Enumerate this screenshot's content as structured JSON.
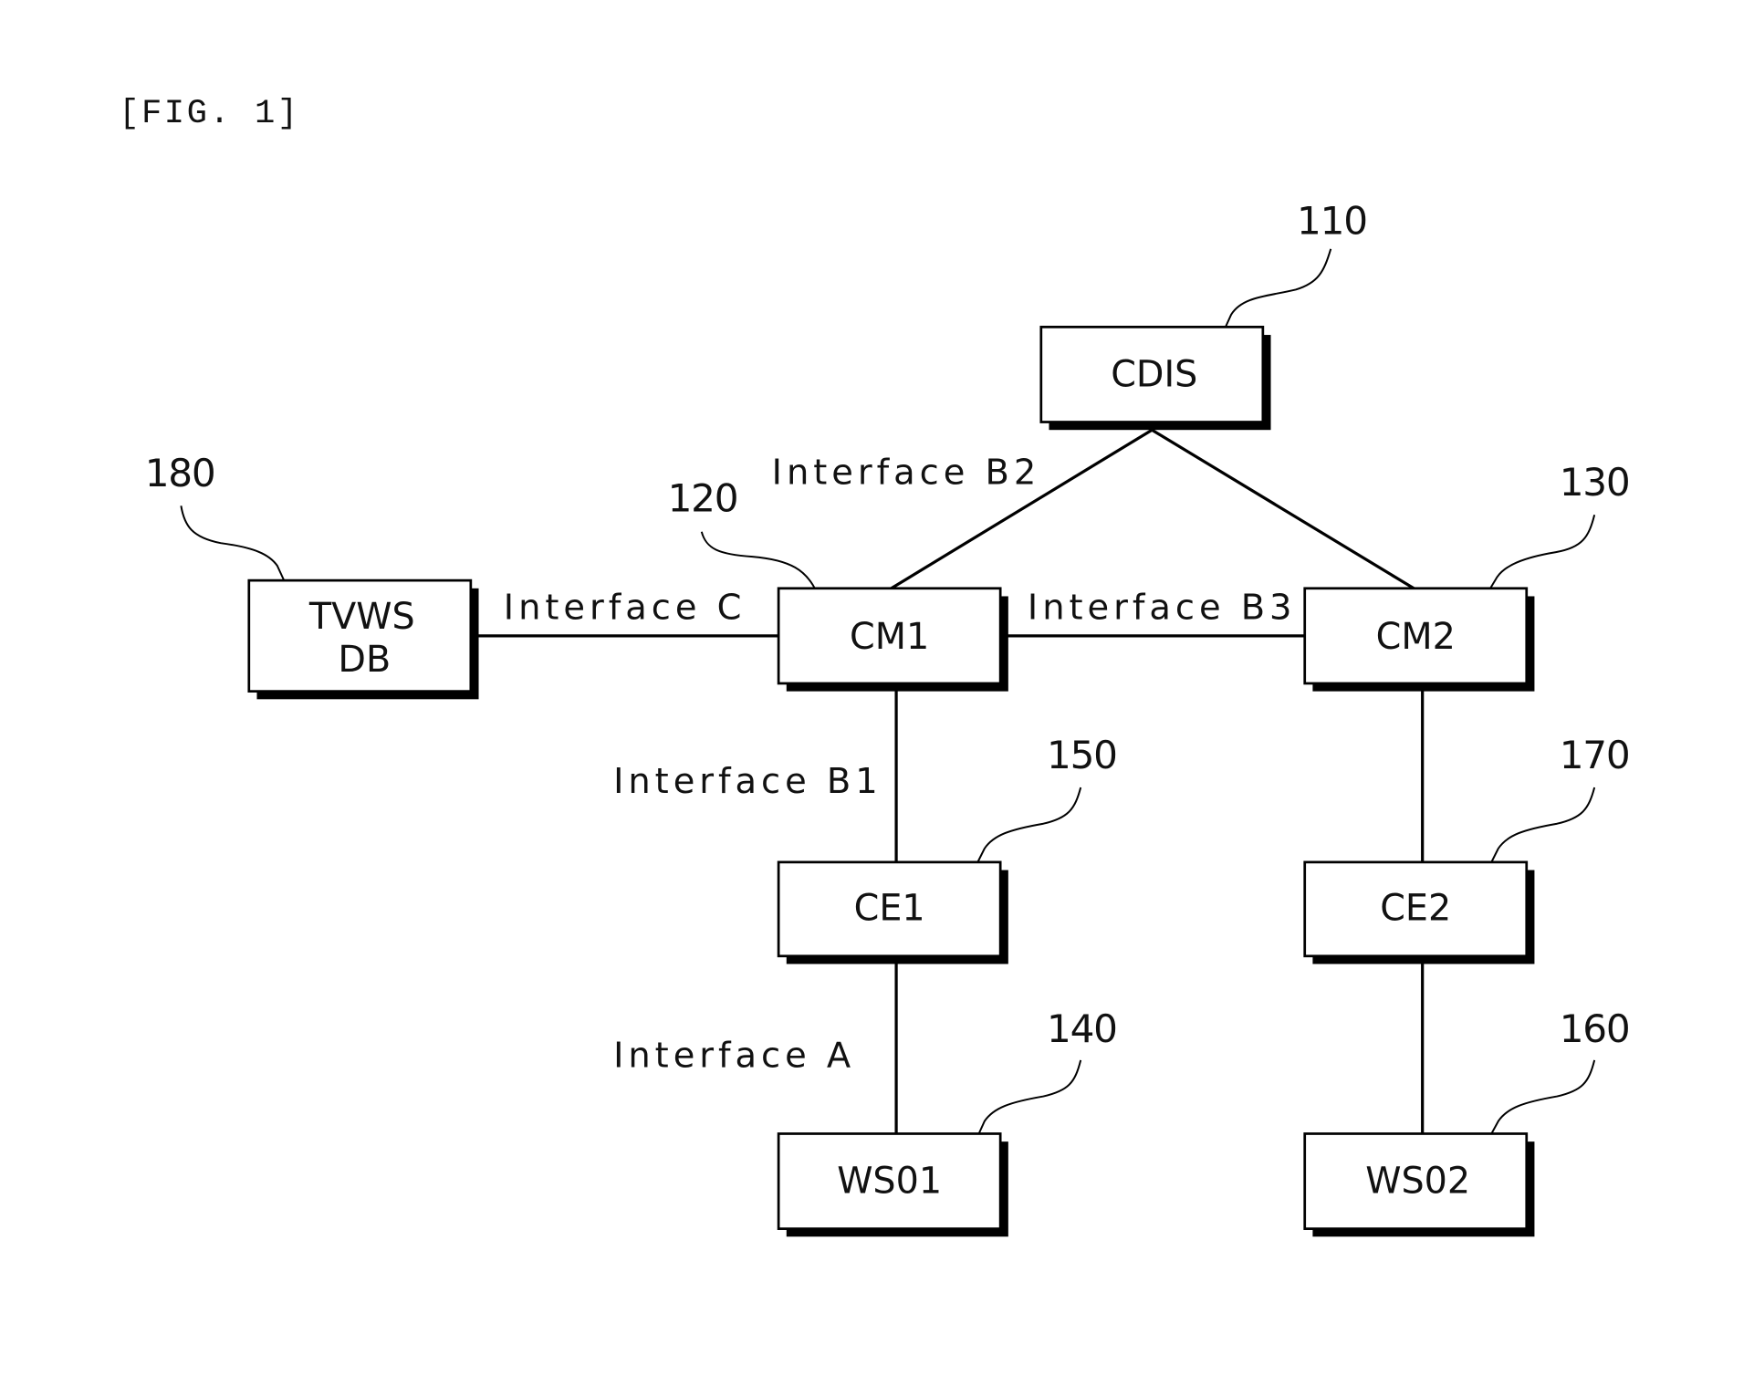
{
  "figure_label": "[FIG. 1]",
  "nodes": [
    {
      "id": "cdis",
      "lines": [
        "CDIS"
      ],
      "ref": "110"
    },
    {
      "id": "cm1",
      "lines": [
        "CM1"
      ],
      "ref": "120"
    },
    {
      "id": "cm2",
      "lines": [
        "CM2"
      ],
      "ref": "130"
    },
    {
      "id": "ws01",
      "lines": [
        "WS01"
      ],
      "ref": "140"
    },
    {
      "id": "ce1",
      "lines": [
        "CE1"
      ],
      "ref": "150"
    },
    {
      "id": "ws02",
      "lines": [
        "WS02"
      ],
      "ref": "160"
    },
    {
      "id": "ce2",
      "lines": [
        "CE2"
      ],
      "ref": "170"
    },
    {
      "id": "tvwsdb",
      "lines": [
        "TVWS",
        "DB"
      ],
      "ref": "180"
    }
  ],
  "edges": [
    {
      "from": "cdis",
      "to": "cm1",
      "label": "Interface B2"
    },
    {
      "from": "cdis",
      "to": "cm2",
      "label": ""
    },
    {
      "from": "tvwsdb",
      "to": "cm1",
      "label": "Interface C"
    },
    {
      "from": "cm1",
      "to": "cm2",
      "label": "Interface B3"
    },
    {
      "from": "cm1",
      "to": "ce1",
      "label": "Interface B1"
    },
    {
      "from": "ce1",
      "to": "ws01",
      "label": "Interface A"
    },
    {
      "from": "cm2",
      "to": "ce2",
      "label": ""
    },
    {
      "from": "ce2",
      "to": "ws02",
      "label": ""
    }
  ]
}
